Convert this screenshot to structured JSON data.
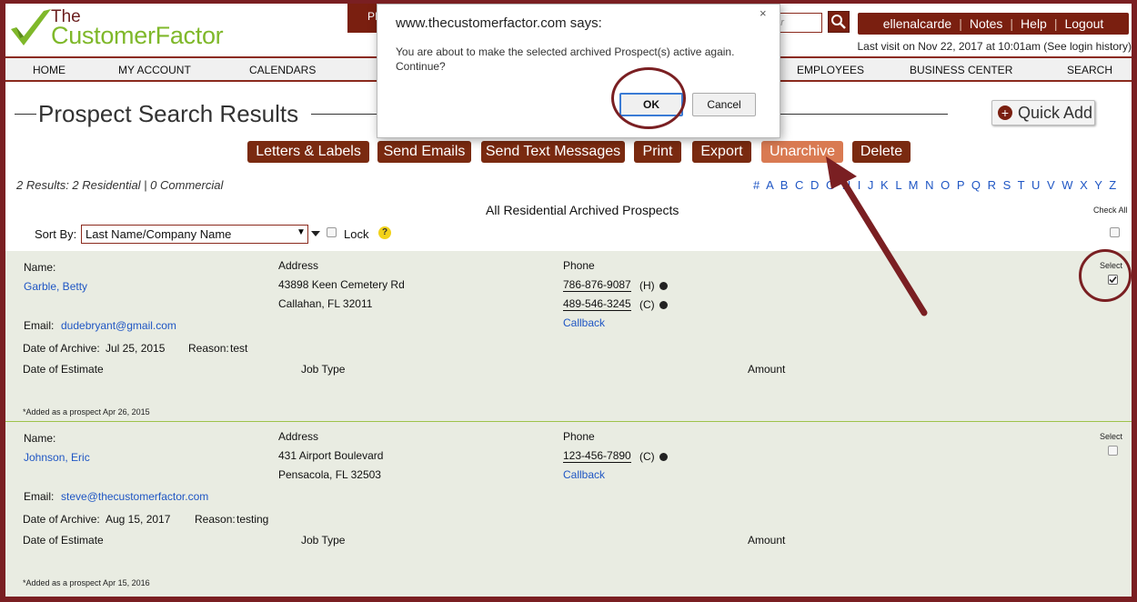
{
  "header": {
    "logo_the": "The",
    "logo_name": "CustomerFactor",
    "search_placeholder": "mer",
    "user": "ellenalcarde",
    "notes": "Notes",
    "help": "Help",
    "logout": "Logout",
    "last_visit": "Last visit on Nov 22, 2017 at 10:01am (See login history)"
  },
  "nav": {
    "home": "HOME",
    "my_account": "MY ACCOUNT",
    "calendars": "CALENDARS",
    "active_partial": "PI",
    "employees": "EMPLOYEES",
    "business_center": "BUSINESS CENTER",
    "search": "SEARCH"
  },
  "page": {
    "title": "Prospect Search Results",
    "quick_add": "Quick Add",
    "results_summary": "2 Results: 2 Residential | 0 Commercial",
    "alpha_index": "# A B C D     G H I J K L M N O P Q R S T U V W X Y Z",
    "section_heading": "All Residential Archived Prospects",
    "check_all": "Check All",
    "sort_by": "Sort By:",
    "sort_value": "Last Name/Company Name",
    "lock": "Lock",
    "help_glyph": "?"
  },
  "actions": {
    "letters": "Letters & Labels",
    "emails": "Send Emails",
    "texts": "Send Text Messages",
    "print": "Print",
    "export": "Export",
    "unarchive": "Unarchive",
    "delete": "Delete"
  },
  "labels": {
    "name": "Name:",
    "address": "Address",
    "phone": "Phone",
    "select": "Select",
    "email": "Email:",
    "date_archive": "Date of Archive:",
    "reason": "Reason:",
    "date_estimate": "Date of Estimate",
    "job_type": "Job Type",
    "amount": "Amount",
    "callback": "Callback"
  },
  "records": [
    {
      "name": "Garble, Betty",
      "addr1": "43898 Keen Cemetery Rd",
      "addr2": "Callahan, FL 32011",
      "phone1": "786-876-9087",
      "phone1_type": "(H)",
      "phone2": "489-546-3245",
      "phone2_type": "(C)",
      "email": "dudebryant@gmail.com",
      "archive_date": "Jul 25, 2015",
      "reason": "test",
      "added": "*Added as a prospect Apr 26, 2015",
      "selected": true
    },
    {
      "name": "Johnson, Eric",
      "addr1": "431 Airport Boulevard",
      "addr2": "Pensacola, FL 32503",
      "phone1": "123-456-7890",
      "phone1_type": "(C)",
      "email": "steve@thecustomerfactor.com",
      "archive_date": "Aug 15, 2017",
      "reason": "testing",
      "added": "*Added as a prospect Apr 15, 2016",
      "selected": false
    }
  ],
  "dialog": {
    "title": "www.thecustomerfactor.com says:",
    "close": "×",
    "message": "You are about to make the selected archived Prospect(s) active again. Continue?",
    "ok": "OK",
    "cancel": "Cancel"
  },
  "colors": {
    "brand_dark": "#7a1f10",
    "highlight": "#d97a52",
    "link": "#1f56c4",
    "annotation": "#7a1f22"
  }
}
